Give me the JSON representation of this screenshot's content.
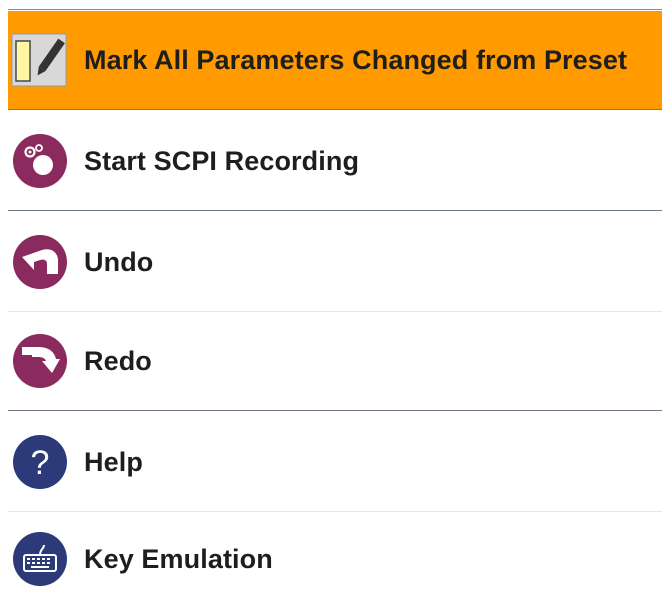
{
  "menu": {
    "items": [
      {
        "label": "Mark All Parameters Changed from Preset",
        "icon": "mark-parameters-icon",
        "highlighted": true
      },
      {
        "label": "Start SCPI Recording",
        "icon": "scpi-recording-icon"
      },
      {
        "label": "Undo",
        "icon": "undo-icon"
      },
      {
        "label": "Redo",
        "icon": "redo-icon"
      },
      {
        "label": "Help",
        "icon": "help-icon"
      },
      {
        "label": "Key Emulation",
        "icon": "keyboard-icon"
      }
    ]
  },
  "colors": {
    "highlight": "#ff9a00",
    "action_icon_bg": "#8a2a5e",
    "help_icon_bg": "#2c3a7a",
    "text": "#1e1e1e"
  }
}
